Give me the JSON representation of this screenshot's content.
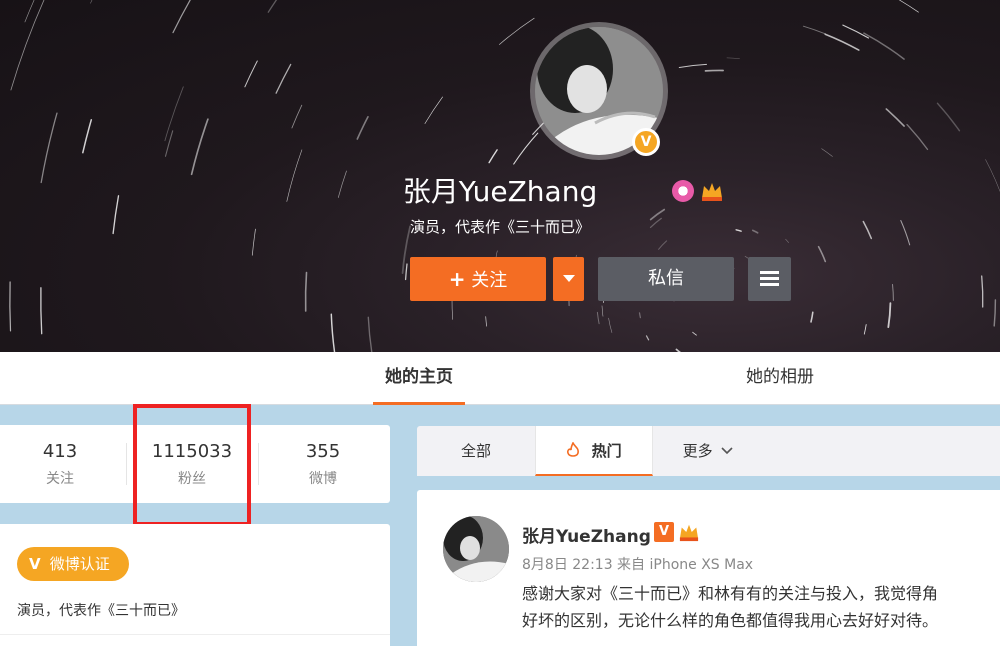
{
  "profile": {
    "name": "张月YueZhang",
    "verified_mark": "V",
    "bio": "演员，代表作《三十而已》",
    "icons": [
      "pink-badge-icon",
      "crown-badge-icon"
    ]
  },
  "actions": {
    "follow_plus": "+",
    "follow_label": "关注",
    "message_label": "私信"
  },
  "tabs": {
    "home": "她的主页",
    "album": "她的相册"
  },
  "stats": {
    "following_count": "413",
    "following_label": "关注",
    "followers_count": "1115033",
    "followers_label": "粉丝",
    "posts_count": "355",
    "posts_label": "微博"
  },
  "info": {
    "verify_mark": "V",
    "verify_label": "微博认证",
    "description": "演员，代表作《三十而已》"
  },
  "feed_tabs": {
    "all": "全部",
    "hot": "热门",
    "more": "更多"
  },
  "post": {
    "author": "张月YueZhang",
    "verified_mark": "V",
    "meta": "8月8日 22:13 来自 iPhone XS Max",
    "text_line1": "感谢大家对《三十而已》和林有有的关注与投入，我觉得角",
    "text_line2": "好坏的区别，无论什么样的角色都值得我用心去好好对待。"
  },
  "colors": {
    "accent": "#f46d23",
    "verified": "#f5a623",
    "highlight": "#ee2222",
    "page_bg": "#b7d6e8"
  }
}
